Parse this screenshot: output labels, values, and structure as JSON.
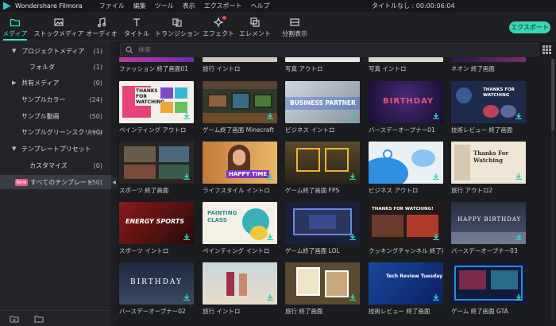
{
  "app": {
    "name": "Wondershare Filmora",
    "project_title": "タイトルなし : 00:00:06:04"
  },
  "menu": [
    "ファイル",
    "編集",
    "ツール",
    "表示",
    "エクスポート",
    "ヘルプ"
  ],
  "toolbar": {
    "tabs": [
      "メディア",
      "ストックメディア",
      "オーディオ",
      "タイトル",
      "トランジション",
      "エフェクト",
      "エレメント",
      "分割表示"
    ],
    "active": "メディア",
    "export_label": "エクスポート",
    "accent": "#3be0c8"
  },
  "sidebar": {
    "items": [
      {
        "label": "プロジェクトメディア",
        "count": "(1)",
        "expanded": true
      },
      {
        "label": "フォルダ",
        "count": "(1)"
      },
      {
        "label": "共有メディア",
        "count": "(0)"
      },
      {
        "label": "サンプルカラー",
        "count": "(24)"
      },
      {
        "label": "サンプル動画",
        "count": "(50)"
      },
      {
        "label": "サンプルグリーンスクリーン",
        "count": "(10)"
      },
      {
        "label": "テンプレートプリセット",
        "count": ""
      },
      {
        "label": "カスタマイズ",
        "count": "(0)"
      },
      {
        "label": "すべてのテンプレート",
        "count": "(50)",
        "badge": "New"
      }
    ]
  },
  "search": {
    "placeholder": "検索"
  },
  "tiles": {
    "row0": [
      "ファッション 終了画面01",
      "旅行 イントロ",
      "写真 アウトロ",
      "写真 イントロ",
      "ネオン 終了画面"
    ],
    "row1": [
      "ペインティング アウトロ",
      "ゲーム終了画面 Minecraft",
      "ビジネス イントロ",
      "バースデーオープナー01",
      "技術レビュー 終了画面"
    ],
    "row2": [
      "スポーツ 終了画面",
      "ライフスタイル イントロ",
      "ゲーム終了画面 FPS",
      "ビジネス アウトロ",
      "旅行 アウトロ2"
    ],
    "row3": [
      "スポーツ イントロ",
      "ペインティング イントロ",
      "ゲーム終了画面 LOL",
      "クッキングチャンネル 終了画面",
      "バースデーオープナー03"
    ],
    "row4": [
      "バースデーオープナー02",
      "旅行 イントロ",
      "旅行 終了画面",
      "技術レビュー 終了画面",
      "ゲーム 終了画面 GTA"
    ]
  },
  "thumb_text": {
    "r1c0": "THANKS FOR WATCHING",
    "r1c2": "BUSINESS PARTNER",
    "r1c3": "BIRTHDAY",
    "r1c4": "THANKS FOR WATCHING",
    "r2c1": "HAPPY TIME",
    "r2c4": "Thanks For Watching",
    "r3c0": "ENERGY SPORTS",
    "r3c1": "PAINTING CLASS",
    "r3c3": "THANKS FOR WATCHING!",
    "r3c4": "HAPPY BIRTHDAY",
    "r4c0": "BIRTHDAY",
    "r4c3": "Tech Review Tuesday"
  }
}
